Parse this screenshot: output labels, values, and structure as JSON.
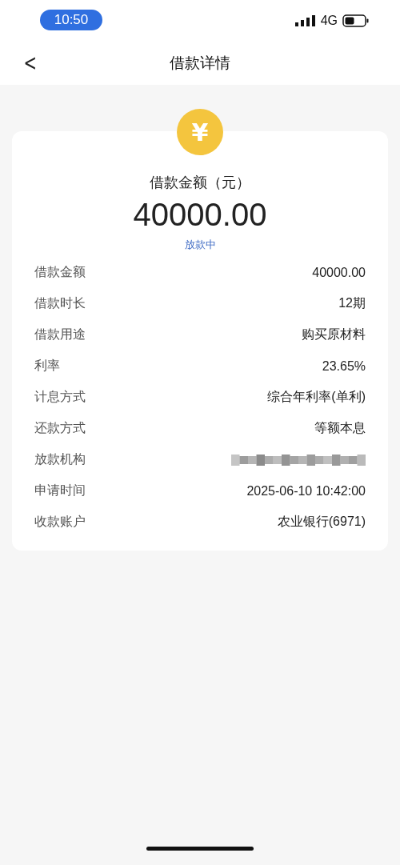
{
  "status_bar": {
    "time": "10:50",
    "network": "4G"
  },
  "nav": {
    "back": "<",
    "title": "借款详情"
  },
  "summary": {
    "currency_symbol": "¥",
    "label": "借款金额（元）",
    "amount": "40000.00",
    "status": "放款中"
  },
  "details": [
    {
      "label": "借款金额",
      "value": "40000.00"
    },
    {
      "label": "借款时长",
      "value": "12期"
    },
    {
      "label": "借款用途",
      "value": "购买原材料"
    },
    {
      "label": "利率",
      "value": "23.65%"
    },
    {
      "label": "计息方式",
      "value": "综合年利率(单利)"
    },
    {
      "label": "还款方式",
      "value": "等额本息"
    },
    {
      "label": "放款机构",
      "redacted": true
    },
    {
      "label": "申请时间",
      "value": "2025-06-10 10:42:00"
    },
    {
      "label": "收款账户",
      "value": "农业银行(6971)"
    }
  ]
}
